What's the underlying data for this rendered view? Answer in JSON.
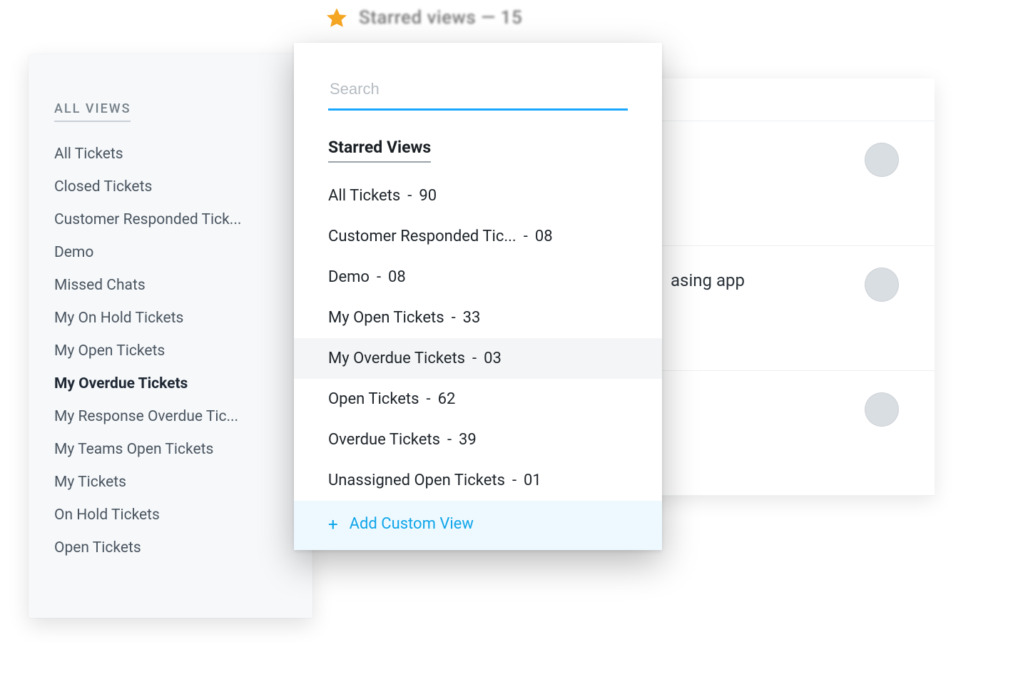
{
  "header": {
    "star_label": "Starred views — 15"
  },
  "sidebar": {
    "section_title": "ALL VIEWS",
    "active_index": 7,
    "items": [
      "All Tickets",
      "Closed Tickets",
      "Customer Responded Tick...",
      "Demo",
      "Missed Chats",
      "My On Hold Tickets",
      "My Open Tickets",
      "My Overdue Tickets",
      "My Response Overdue Tic...",
      "My Teams Open Tickets",
      "My Tickets",
      "On Hold Tickets",
      "Open Tickets"
    ]
  },
  "dropdown": {
    "search_placeholder": "Search",
    "group_title": "Starred Views",
    "highlight_index": 4,
    "rows": [
      {
        "label": "All Tickets",
        "count": "90"
      },
      {
        "label": "Customer Responded Tic...",
        "count": "08"
      },
      {
        "label": "Demo",
        "count": "08"
      },
      {
        "label": "My Open Tickets",
        "count": "33"
      },
      {
        "label": "My Overdue Tickets",
        "count": "03"
      },
      {
        "label": "Open Tickets",
        "count": "62"
      },
      {
        "label": "Overdue Tickets",
        "count": "39"
      },
      {
        "label": "Unassigned Open Tickets",
        "count": "01"
      }
    ],
    "separator": "-",
    "add_label": "Add Custom View"
  },
  "background": {
    "row_snippet": "asing app"
  }
}
